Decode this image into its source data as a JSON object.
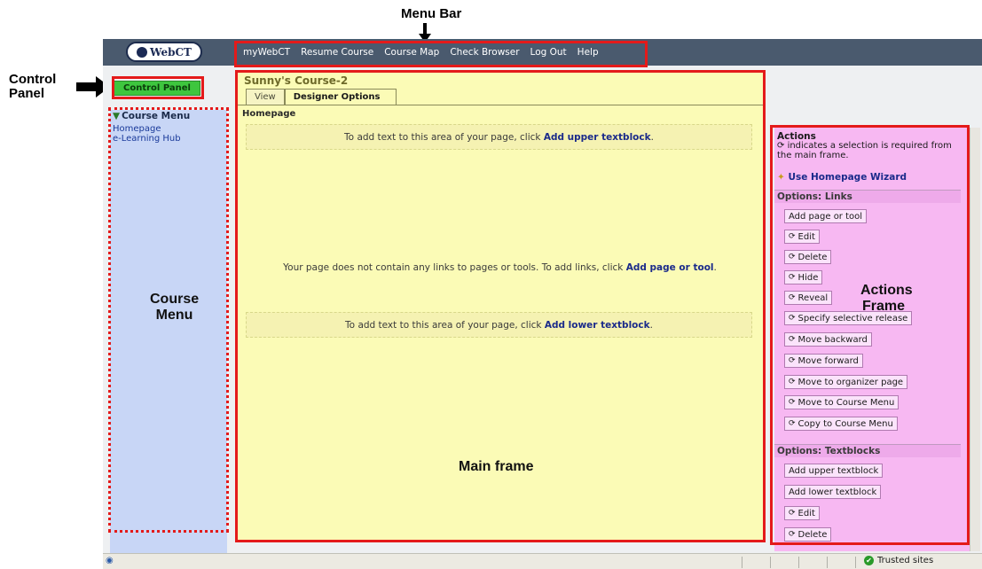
{
  "annotations": {
    "menu_bar": "Menu Bar",
    "control_panel_line1": "Control",
    "control_panel_line2": "Panel",
    "course_menu_line1": "Course",
    "course_menu_line2": "Menu",
    "actions_frame_line1": "Actions",
    "actions_frame_line2": "Frame",
    "main_frame": "Main frame"
  },
  "topbar": {
    "logo": "WebCT",
    "menu_items": [
      "myWebCT",
      "Resume Course",
      "Course Map",
      "Check Browser",
      "Log Out",
      "Help"
    ]
  },
  "control_panel": {
    "label": "Control Panel"
  },
  "course_menu": {
    "heading": "Course Menu",
    "links": [
      "Homepage",
      "e-Learning Hub"
    ]
  },
  "main": {
    "course_title": "Sunny's Course-2",
    "tabs": [
      "View",
      "Designer Options"
    ],
    "page_label": "Homepage",
    "upper_text": "To add text to this area of your page, click ",
    "upper_link": "Add upper textblock",
    "links_text": "Your page does not contain any links to pages or tools. To add links, click ",
    "links_link": "Add page or tool",
    "lower_text": "To add text to this area of your page, click ",
    "lower_link": "Add lower textblock",
    "period": "."
  },
  "actions": {
    "heading": "Actions",
    "note": "indicates a selection is required from the main frame.",
    "wizard": "Use Homepage Wizard",
    "links_section": "Options: Links",
    "links_buttons": [
      "Add page or tool",
      "Edit",
      "Delete",
      "Hide",
      "Reveal",
      "Specify selective release",
      "Move backward",
      "Move forward",
      "Move to organizer page",
      "Move to Course Menu",
      "Copy to Course Menu"
    ],
    "textblocks_section": "Options: Textblocks",
    "textblock_buttons": [
      "Add upper textblock",
      "Add lower textblock",
      "Edit",
      "Delete"
    ]
  },
  "statusbar": {
    "zone": "Trusted sites"
  },
  "colors": {
    "annotation_red": "#e41a1a",
    "main_frame": "#fbfbb6",
    "course_menu": "#c8d6f6",
    "actions_frame": "#f7b8f2",
    "control_panel": "#3ec63e",
    "topbar": "#4a5a6e"
  }
}
